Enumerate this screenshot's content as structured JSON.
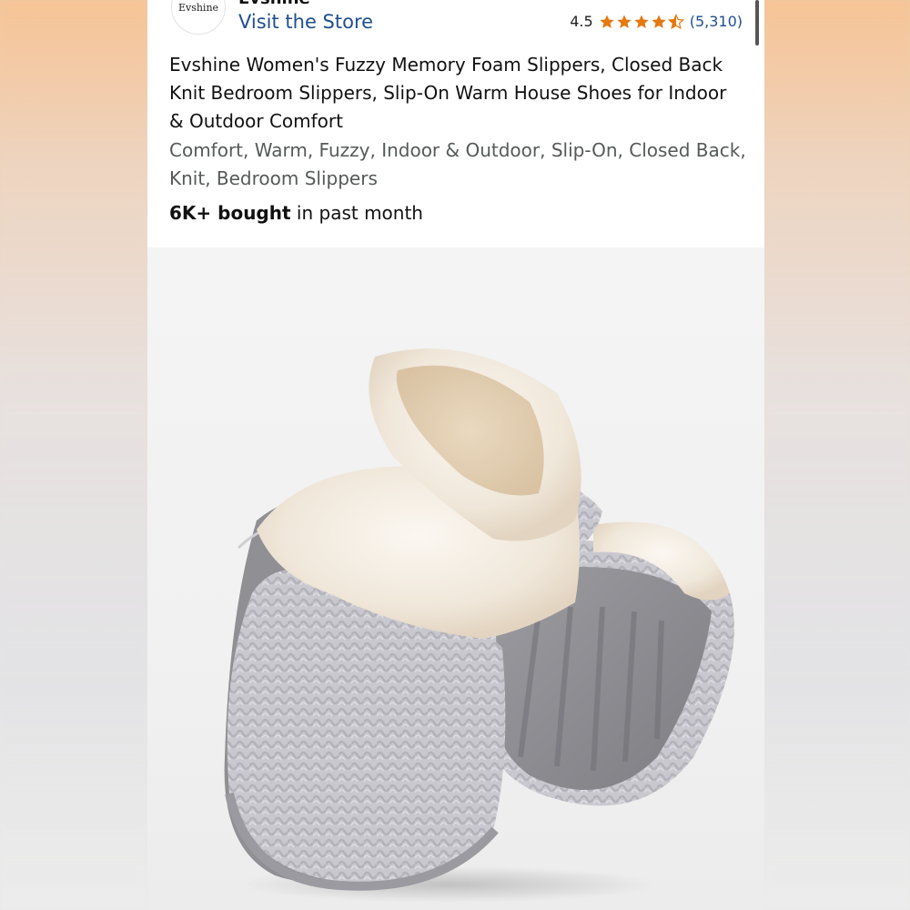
{
  "store": {
    "logo_text": "Evshine",
    "brand_name_cut": "Evshine",
    "visit_label": "Visit the Store"
  },
  "rating": {
    "value": "4.5",
    "stars": 4.5,
    "count": "(5,310)",
    "star_color": "#e47911"
  },
  "product": {
    "title": "Evshine Women's Fuzzy Memory Foam Slippers, Closed Back Knit Bedroom Slippers, Slip-On Warm House Shoes for Indoor & Outdoor Comfort",
    "keywords": "Comfort, Warm, Fuzzy, Indoor & Outdoor, Slip-On, Closed Back, Knit, Bedroom Slippers",
    "bought_bold": "6K+ bought",
    "bought_rest": " in past month"
  },
  "colors": {
    "link": "#1f4f8f",
    "knit": "#c9c8cf",
    "fur": "#f3ece2",
    "sole": "#8e8e92"
  }
}
